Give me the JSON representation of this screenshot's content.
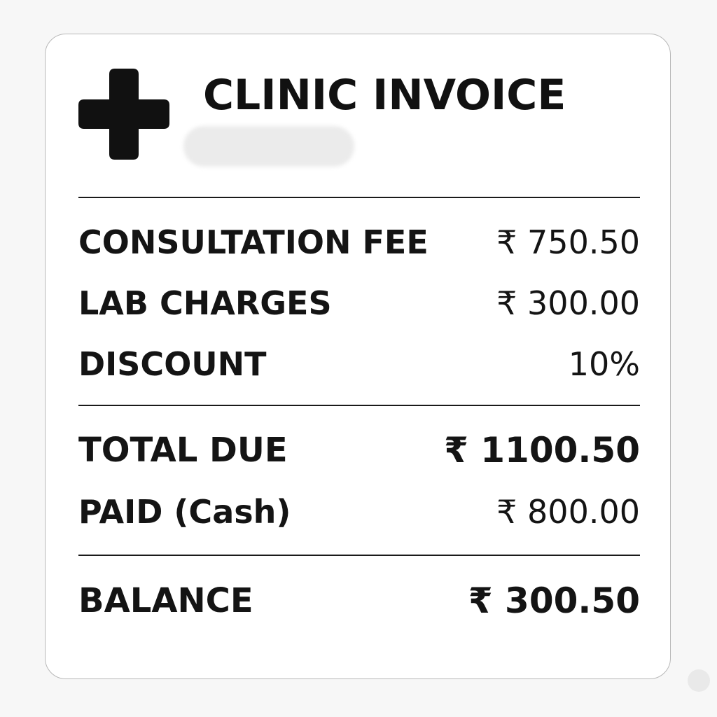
{
  "header": {
    "title": "CLINIC INVOICE",
    "logo_icon": "medical-cross-icon"
  },
  "line_items": [
    {
      "label": "CONSULTATION FEE",
      "value": "₹ 750.50"
    },
    {
      "label": "LAB CHARGES",
      "value": "₹ 300.00"
    },
    {
      "label": "DISCOUNT",
      "value": "10%"
    }
  ],
  "totals": [
    {
      "label": "TOTAL DUE",
      "value": "₹ 1100.50"
    },
    {
      "label": "PAID (Cash)",
      "value": "₹ 800.00"
    }
  ],
  "balance": {
    "label": "BALANCE",
    "value": "₹ 300.50"
  },
  "colors": {
    "text": "#111111",
    "card": "#ffffff",
    "background": "#f7f7f7"
  }
}
